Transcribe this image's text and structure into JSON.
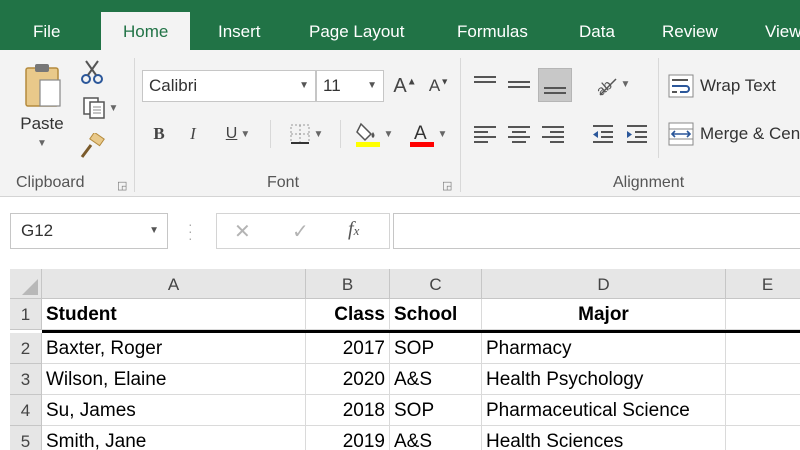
{
  "tabs": [
    {
      "id": "file",
      "label": "File"
    },
    {
      "id": "home",
      "label": "Home"
    },
    {
      "id": "insert",
      "label": "Insert"
    },
    {
      "id": "pagelayout",
      "label": "Page Layout"
    },
    {
      "id": "formulas",
      "label": "Formulas"
    },
    {
      "id": "data",
      "label": "Data"
    },
    {
      "id": "review",
      "label": "Review"
    },
    {
      "id": "view",
      "label": "View"
    }
  ],
  "active_tab": "Home",
  "ribbon": {
    "clipboard": {
      "paste_label": "Paste",
      "group_label": "Clipboard"
    },
    "font": {
      "font_name": "Calibri",
      "font_size": "11",
      "group_label": "Font",
      "fill_color": "#ffff00",
      "font_color": "#ff0000"
    },
    "alignment": {
      "wrap_text_label": "Wrap Text",
      "merge_label": "Merge & Center",
      "group_label": "Alignment"
    }
  },
  "formula_bar": {
    "name_box": "G12",
    "formula": ""
  },
  "grid": {
    "columns": [
      {
        "label": "A"
      },
      {
        "label": "B"
      },
      {
        "label": "C"
      },
      {
        "label": "D"
      },
      {
        "label": "E"
      }
    ],
    "rows": [
      {
        "num": "1",
        "cells": [
          "Student",
          "Class",
          "School",
          "Major",
          ""
        ]
      },
      {
        "num": "2",
        "cells": [
          "Baxter, Roger",
          "2017",
          "SOP",
          "Pharmacy",
          ""
        ]
      },
      {
        "num": "3",
        "cells": [
          "Wilson, Elaine",
          "2020",
          "A&S",
          "Health Psychology",
          ""
        ]
      },
      {
        "num": "4",
        "cells": [
          "Su, James",
          "2018",
          "SOP",
          "Pharmaceutical Science",
          ""
        ]
      },
      {
        "num": "5",
        "cells": [
          "Smith, Jane",
          "2019",
          "A&S",
          "Health Sciences",
          ""
        ]
      }
    ]
  },
  "colors": {
    "accent": "#217346"
  }
}
